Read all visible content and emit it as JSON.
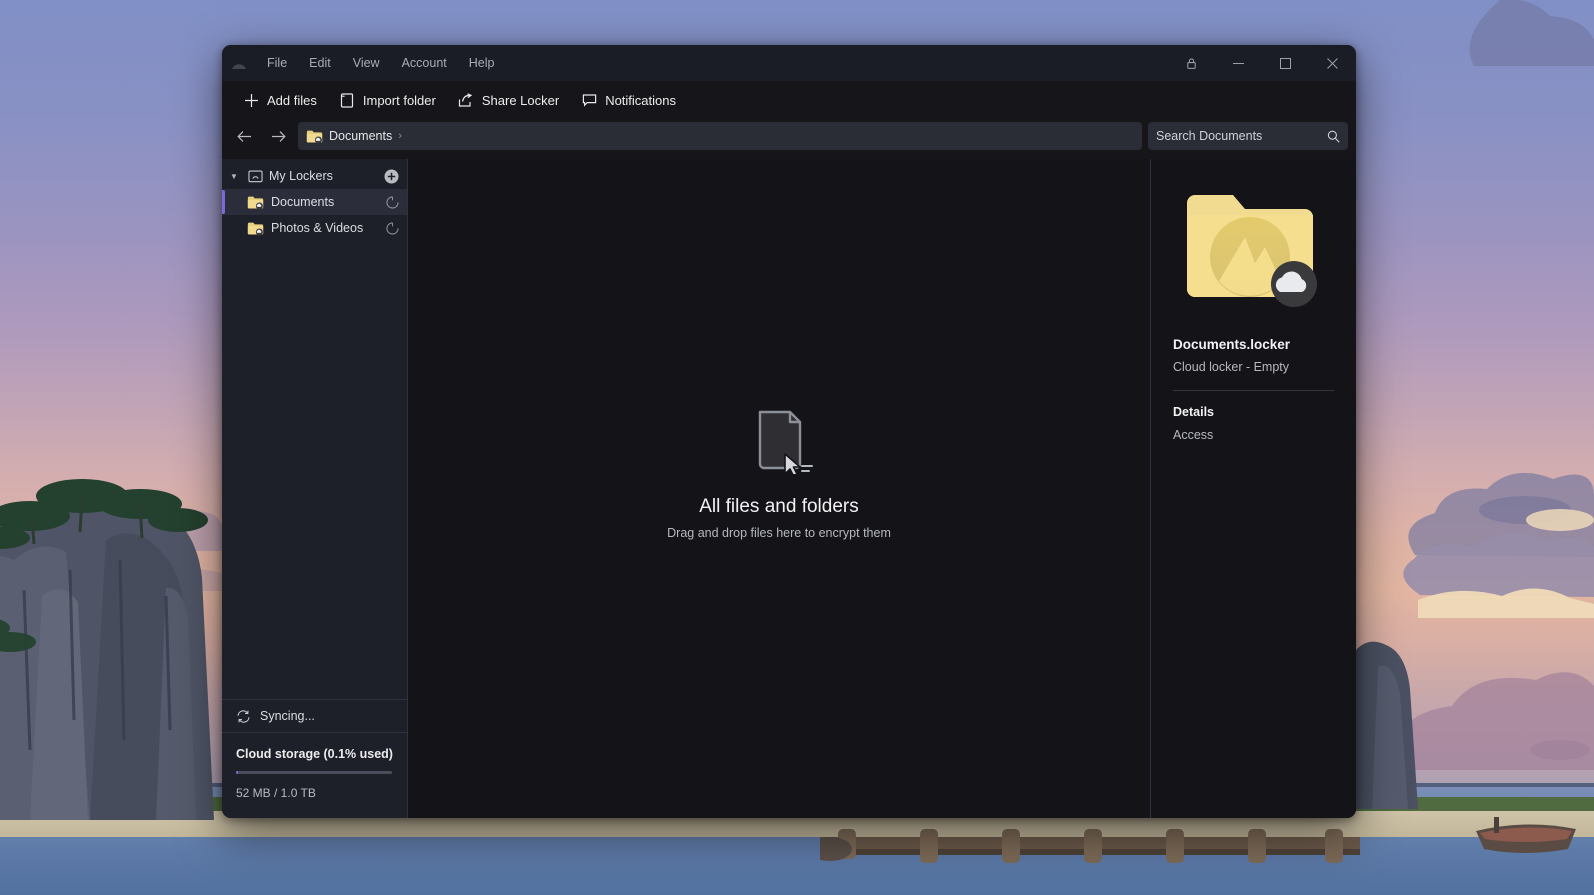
{
  "window": {
    "title_menus": [
      "File",
      "Edit",
      "View",
      "Account",
      "Help"
    ],
    "logo_icon": "nordlocker-mountain-logo",
    "controls": {
      "lock_icon": "lock-icon",
      "minimize_icon": "minimize-icon",
      "maximize_icon": "maximize-icon",
      "close_icon": "close-icon"
    }
  },
  "toolbar": {
    "items": [
      {
        "label": "Add files",
        "icon": "plus-icon"
      },
      {
        "label": "Import folder",
        "icon": "folder-import-icon"
      },
      {
        "label": "Share Locker",
        "icon": "share-icon"
      },
      {
        "label": "Notifications",
        "icon": "comment-icon"
      }
    ]
  },
  "address": {
    "back_icon": "arrow-left-icon",
    "forward_icon": "arrow-right-icon",
    "crumb": "Documents",
    "crumb_separator": "›",
    "crumb_folder_icon": "cloud-folder-icon"
  },
  "search": {
    "placeholder": "Search Documents",
    "value": "Search Documents",
    "icon": "search-icon"
  },
  "sidebar": {
    "root": {
      "label": "My Lockers",
      "icon": "lockers-icon",
      "add_icon": "add-circle-icon",
      "expanded": true
    },
    "items": [
      {
        "label": "Documents",
        "icon": "cloud-folder-icon",
        "status_icon": "sync-pending-icon",
        "selected": true
      },
      {
        "label": "Photos & Videos",
        "icon": "cloud-folder-icon",
        "status_icon": "sync-pending-icon",
        "selected": false
      }
    ],
    "sync": {
      "label": "Syncing...",
      "icon": "sync-icon"
    },
    "storage": {
      "title": "Cloud storage (0.1% used)",
      "usage_text": "52 MB / 1.0 TB",
      "percent": 0.1
    }
  },
  "content": {
    "empty_icon": "file-drag-icon",
    "title": "All files and folders",
    "subtitle": "Drag and drop files here to encrypt them"
  },
  "details": {
    "thumb_icon": "cloud-locker-folder-icon",
    "name": "Documents.locker",
    "subtitle": "Cloud locker - Empty",
    "section_title": "Details",
    "access_label": "Access"
  },
  "colors": {
    "accent": "#7b68d9",
    "folder_yellow": "#f5dd8a",
    "titlebar": "#1b1d26",
    "sidebar": "#1e2029",
    "content": "#141418"
  }
}
